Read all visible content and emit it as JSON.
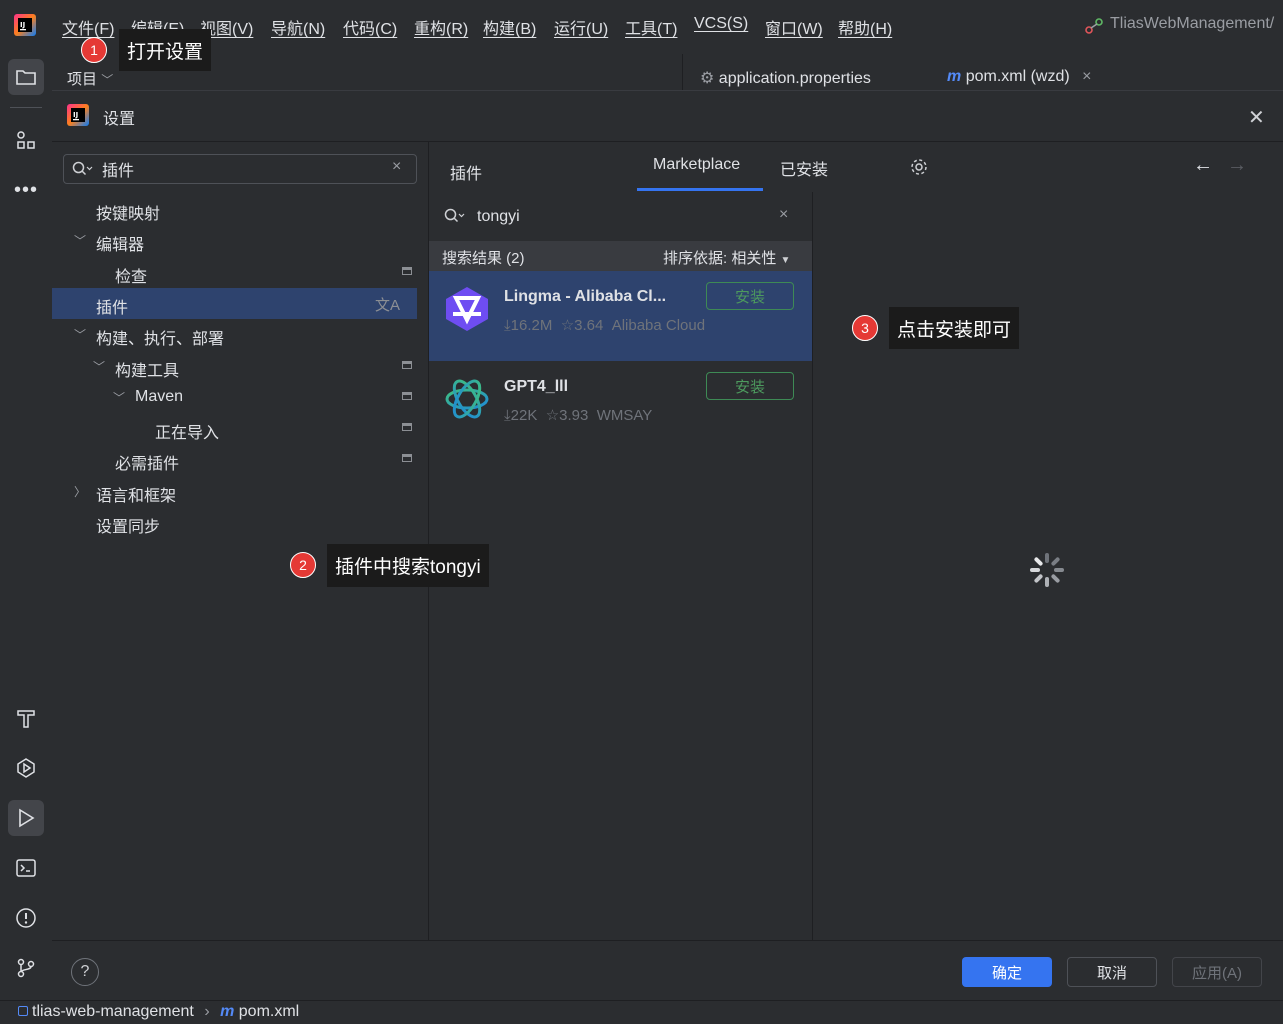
{
  "menubar": {
    "items": [
      "文件(F)",
      "编辑(E)",
      "视图(V)",
      "导航(N)",
      "代码(C)",
      "重构(R)",
      "构建(B)",
      "运行(U)",
      "工具(T)",
      "VCS(S)",
      "窗口(W)",
      "帮助(H)"
    ],
    "project_title": "TliasWebManagement/"
  },
  "ide": {
    "project_label": "项目",
    "editor_tabs": [
      {
        "label": "application.properties",
        "icon": "gear-icon"
      },
      {
        "label": "pom.xml (wzd)",
        "icon": "maven-m-icon"
      }
    ]
  },
  "dialog": {
    "title": "设置",
    "search_value": "插件",
    "tree": [
      {
        "label": "按键映射",
        "expanded": null,
        "project_mark": false
      },
      {
        "label": "编辑器",
        "expanded": true,
        "project_mark": false
      },
      {
        "label": "检查",
        "expanded": null,
        "project_mark": true
      },
      {
        "label": "插件",
        "expanded": null,
        "project_mark": false,
        "selected": true
      },
      {
        "label": "构建、执行、部署",
        "expanded": true,
        "project_mark": false
      },
      {
        "label": "构建工具",
        "expanded": true,
        "project_mark": true
      },
      {
        "label": "Maven",
        "expanded": true,
        "project_mark": true
      },
      {
        "label": "正在导入",
        "expanded": null,
        "project_mark": true
      },
      {
        "label": "必需插件",
        "expanded": null,
        "project_mark": true
      },
      {
        "label": "语言和框架",
        "expanded": false,
        "project_mark": false
      },
      {
        "label": "设置同步",
        "expanded": null,
        "project_mark": false
      }
    ],
    "plugins": {
      "title": "插件",
      "tabs": [
        "Marketplace",
        "已安装"
      ],
      "active_tab": "Marketplace",
      "search_value": "tongyi",
      "results_label": "搜索结果 (2)",
      "sort_label": "排序依据: 相关性",
      "items": [
        {
          "name": "Lingma - Alibaba Cl...",
          "downloads": "16.2M",
          "rating": "3.64",
          "vendor": "Alibaba Cloud",
          "install_label": "安装",
          "selected": true
        },
        {
          "name": "GPT4_lll",
          "downloads": "22K",
          "rating": "3.93",
          "vendor": "WMSAY",
          "install_label": "安装",
          "selected": false
        }
      ]
    },
    "buttons": {
      "ok": "确定",
      "cancel": "取消",
      "apply": "应用(A)"
    }
  },
  "statusbar": {
    "path": [
      "tlias-web-management",
      "pom.xml"
    ]
  },
  "annotations": [
    {
      "number": "1",
      "text": "打开设置"
    },
    {
      "number": "2",
      "text": "插件中搜索tongyi"
    },
    {
      "number": "3",
      "text": "点击安装即可"
    }
  ],
  "colors": {
    "accent": "#3574f0",
    "selection": "#2e436e",
    "install_green": "#4d9a5e",
    "badge_red": "#e53935"
  }
}
